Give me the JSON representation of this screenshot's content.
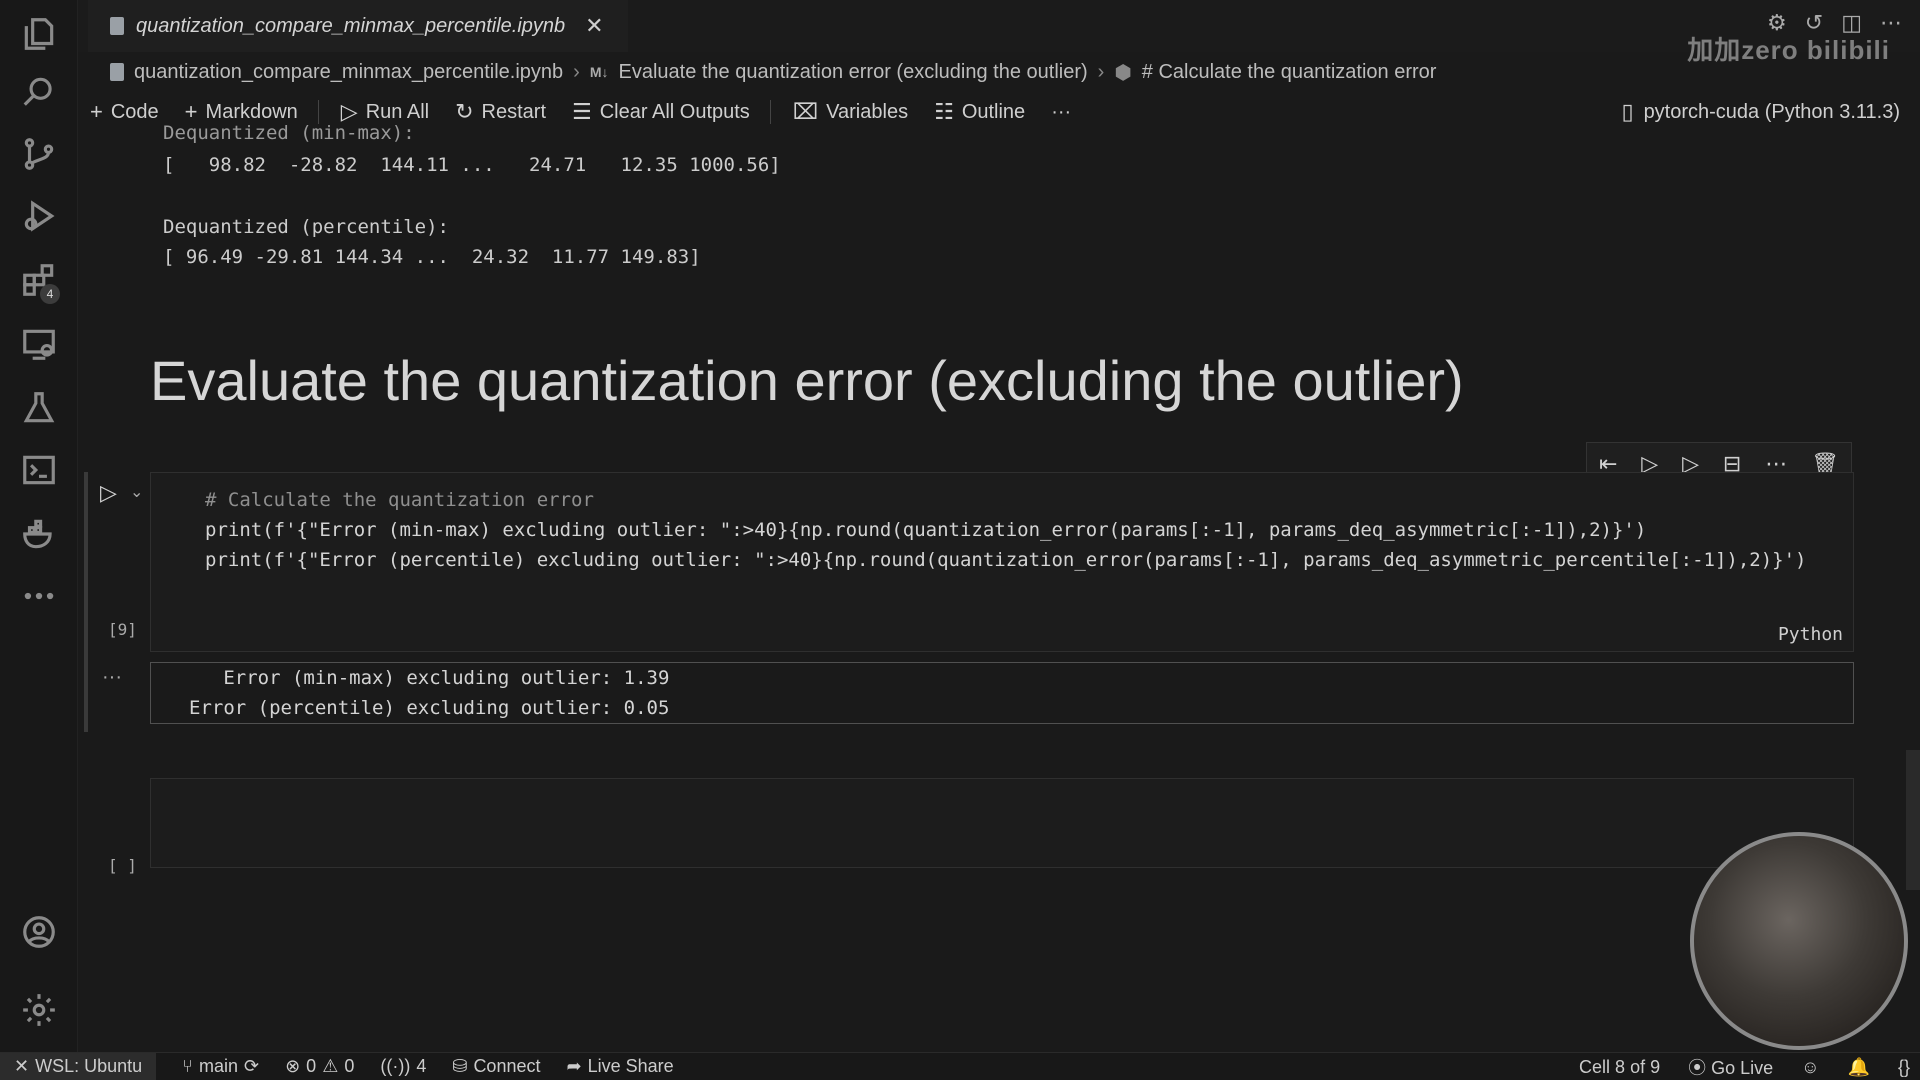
{
  "tab": {
    "title": "quantization_compare_minmax_percentile.ipynb",
    "close": "✕"
  },
  "watermark": "加加zero bilibili",
  "breadcrumb": {
    "file": "quantization_compare_minmax_percentile.ipynb",
    "md_tag": "M↓",
    "section": "Evaluate the quantization error (excluding the outlier)",
    "cell": "# Calculate the quantization error"
  },
  "toolbar": {
    "code": "Code",
    "markdown": "Markdown",
    "run_all": "Run All",
    "restart": "Restart",
    "clear_outputs": "Clear All Outputs",
    "variables": "Variables",
    "outline": "Outline",
    "more": "···",
    "kernel": "pytorch-cuda (Python 3.11.3)"
  },
  "prev_output": {
    "line1": "Dequantized (min-max):",
    "line2": "[   98.82  -28.82  144.11 ...   24.71   12.35 1000.56]",
    "line3": "Dequantized (percentile):",
    "line4": "[ 96.49 -29.81 144.34 ...  24.32  11.77 149.83]"
  },
  "heading": "Evaluate the quantization error (excluding the outlier)",
  "code_cell": {
    "execution_count": "[9]",
    "comment": "# Calculate the quantization error",
    "line2": "print(f'{\"Error (min-max) excluding outlier: \":>40}{np.round(quantization_error(params[:-1], params_deq_asymmetric[:-1]),2)}')",
    "line3": "print(f'{\"Error (percentile) excluding outlier: \":>40}{np.round(quantization_error(params[:-1], params_deq_asymmetric_percentile[:-1]),2)}')",
    "language": "Python"
  },
  "output": {
    "line1": "   Error (min-max) excluding outlier: 1.39",
    "line2": "Error (percentile) excluding outlier: 0.05",
    "more": "···"
  },
  "empty_cell": {
    "execution_count": "[ ]"
  },
  "statusbar": {
    "remote": "WSL: Ubuntu",
    "branch": "main",
    "errors": "0",
    "warnings": "0",
    "ports": "4",
    "connect": "Connect",
    "live_share": "Live Share",
    "cell_pos": "Cell 8 of 9",
    "go_live": "Go Live"
  }
}
